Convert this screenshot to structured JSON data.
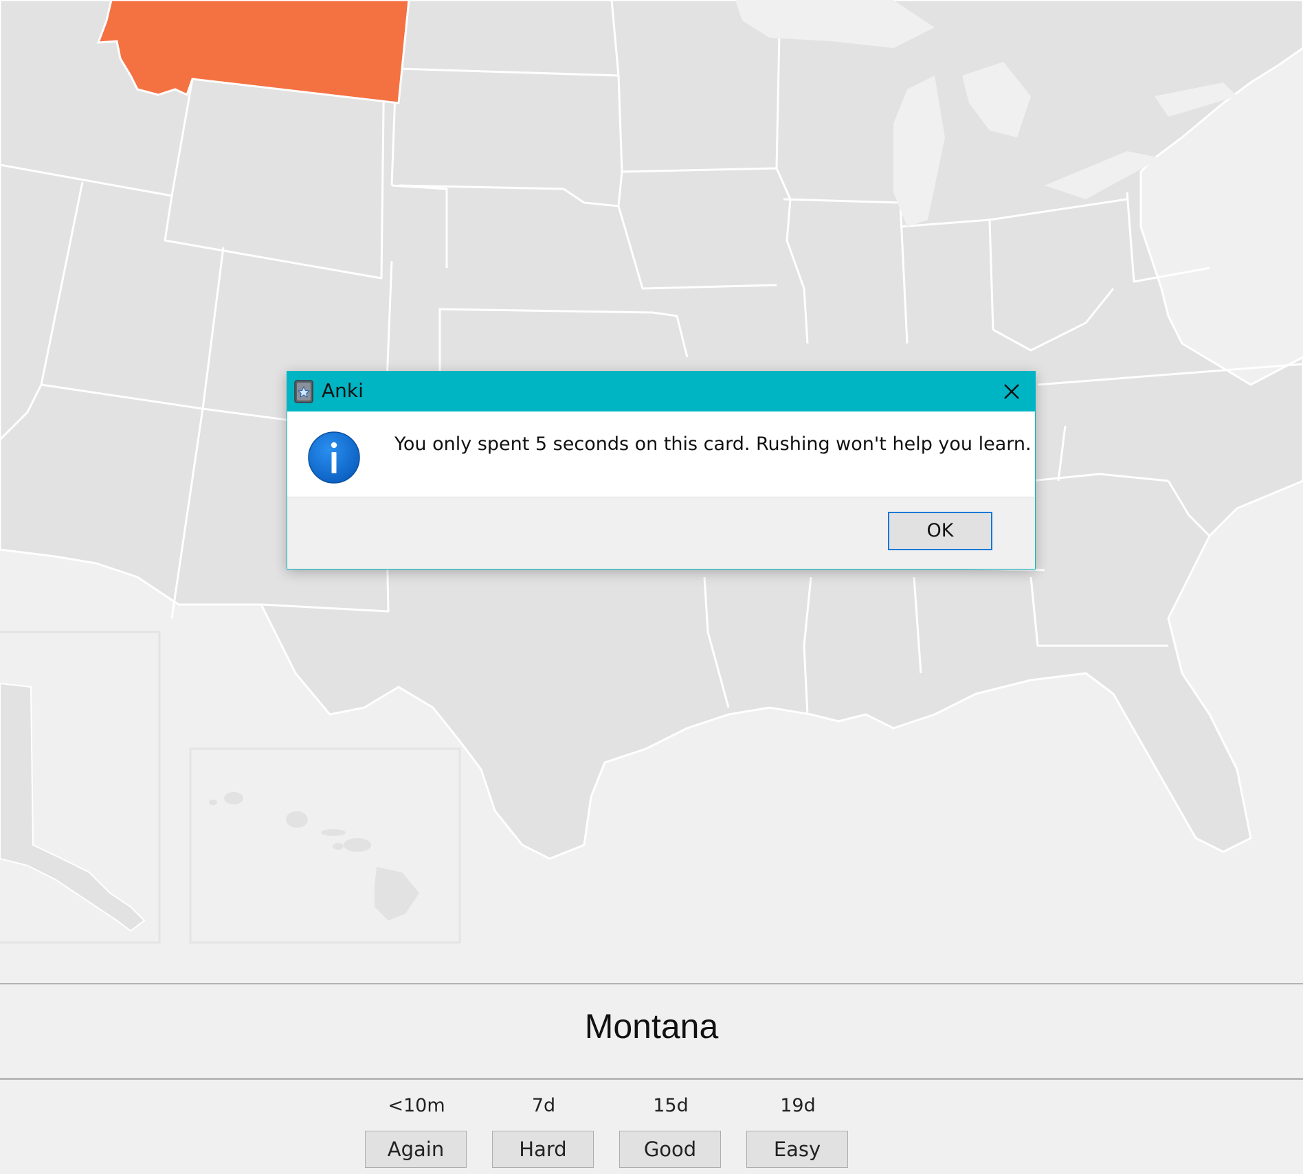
{
  "dialog": {
    "title": "Anki",
    "message": "You only spent 5 seconds on this card. Rushing won't help you learn.",
    "ok_label": "OK",
    "icons": {
      "app": "anki-app-icon",
      "info": "info-icon",
      "close": "close-icon"
    },
    "colors": {
      "titlebar": "#00b5c3",
      "info_icon": "#0a72d0"
    }
  },
  "card": {
    "answer": "Montana",
    "highlight_color": "#f47142",
    "map_color": "#e2e2e2"
  },
  "answer_buttons": [
    {
      "interval": "<10m",
      "label": "Again"
    },
    {
      "interval": "7d",
      "label": "Hard"
    },
    {
      "interval": "15d",
      "label": "Good"
    },
    {
      "interval": "19d",
      "label": "Easy"
    }
  ]
}
